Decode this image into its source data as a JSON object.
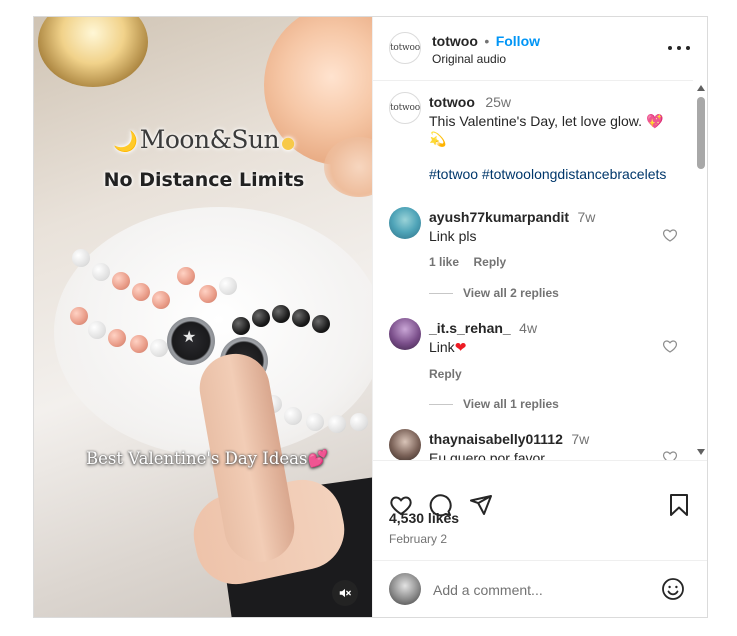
{
  "media": {
    "overlay_title": "Moon&Sun",
    "overlay_subtitle": "No Distance Limits",
    "overlay_bottom": "Best Valentine's Day Ideas",
    "mute_icon": "speaker-muted-icon"
  },
  "header": {
    "avatar_text": "totwoo",
    "username": "totwoo",
    "separator": "•",
    "follow_label": "Follow",
    "audio_label": "Original audio"
  },
  "caption": {
    "avatar_text": "totwoo",
    "username": "totwoo",
    "time": "25w",
    "text": "This Valentine's Day, let love glow.",
    "emoji": "💖 💫",
    "hashtags": "#totwoo #totwoolongdistancebracelets"
  },
  "comments": [
    {
      "username": "ayush77kumarpandit",
      "time": "7w",
      "text": "Link pls",
      "likes": "1 like",
      "reply_label": "Reply",
      "view_replies": "View all 2 replies"
    },
    {
      "username": "_it.s_rehan_",
      "time": "4w",
      "text": "Link",
      "emoji": "❤",
      "reply_label": "Reply",
      "view_replies": "View all 1 replies"
    },
    {
      "username": "thaynaisabelly01112",
      "time": "7w",
      "text": "Eu quero por favor"
    }
  ],
  "actions": {
    "likes": "4,530 likes",
    "date": "February 2"
  },
  "add_comment": {
    "placeholder": "Add a comment...",
    "emoji_icon": "smiley-icon"
  },
  "colors": {
    "accent": "#0095f6",
    "text": "#262626",
    "muted": "#737373",
    "border": "#dbdbdb",
    "heart_red": "#ed1c24"
  }
}
